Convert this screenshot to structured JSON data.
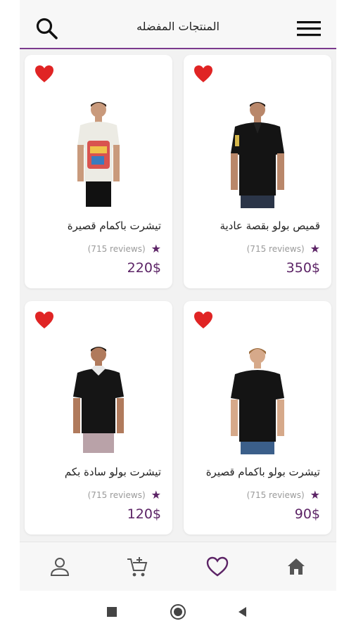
{
  "header": {
    "title": "المنتجات المفضله",
    "search_icon": "search-icon",
    "menu_icon": "hamburger-menu-icon"
  },
  "colors": {
    "accent": "#5c2466",
    "header_line": "#7b3a8e",
    "heart": "#e02424",
    "reviews_text": "#9a9a9a"
  },
  "products": [
    {
      "name": "تيشرت باكمام قصيرة",
      "reviews": "(715 reviews)",
      "price": "220$",
      "favorite_icon": "heart-icon"
    },
    {
      "name": "قميص بولو بقصة عادية",
      "reviews": "(715 reviews)",
      "price": "350$",
      "favorite_icon": "heart-icon"
    },
    {
      "name": "تيشرت بولو سادة بكم",
      "reviews": "(715 reviews)",
      "price": "120$",
      "favorite_icon": "heart-icon"
    },
    {
      "name": "تيشرت بولو باكمام قصيرة",
      "reviews": "(715 reviews)",
      "price": "90$",
      "favorite_icon": "heart-icon"
    }
  ],
  "bottom_nav": {
    "items": [
      "profile-icon",
      "add-to-cart-icon",
      "favorites-heart-icon",
      "home-icon"
    ],
    "active": "favorites-heart-icon"
  },
  "system_nav": [
    "recent-apps-icon",
    "home-circle-icon",
    "back-triangle-icon"
  ]
}
